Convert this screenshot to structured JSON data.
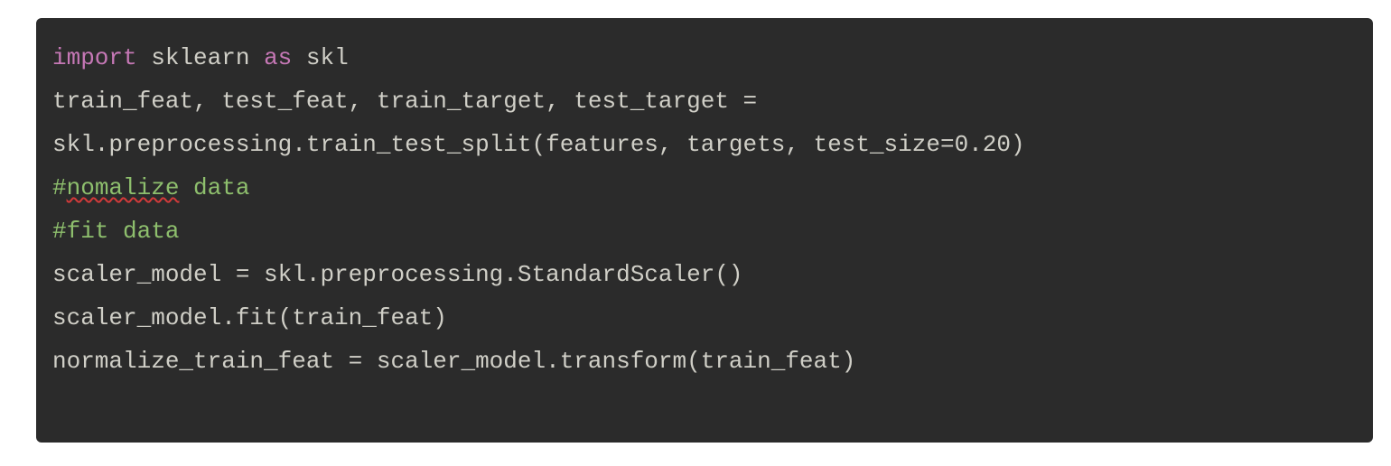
{
  "code": {
    "line1": {
      "kw_import": "import",
      "module": " sklearn ",
      "kw_as": "as",
      "alias": " skl"
    },
    "line2": "train_feat, test_feat, train_target, test_target = ",
    "line3": "skl.preprocessing.train_test_split(features, targets, test_size=0.20)",
    "line4": {
      "hash": "#",
      "misspelled": "nomalize",
      "rest": " data"
    },
    "line5": "#fit data",
    "line6": "scaler_model = skl.preprocessing.StandardScaler()",
    "line7": "scaler_model.fit(train_feat)",
    "line8": "normalize_train_feat = scaler_model.transform(train_feat)"
  },
  "colors": {
    "background": "#2b2b2b",
    "text": "#d0cfc7",
    "keyword": "#c678b6",
    "comment": "#8ebf6d",
    "squiggle": "#d43a3a"
  }
}
